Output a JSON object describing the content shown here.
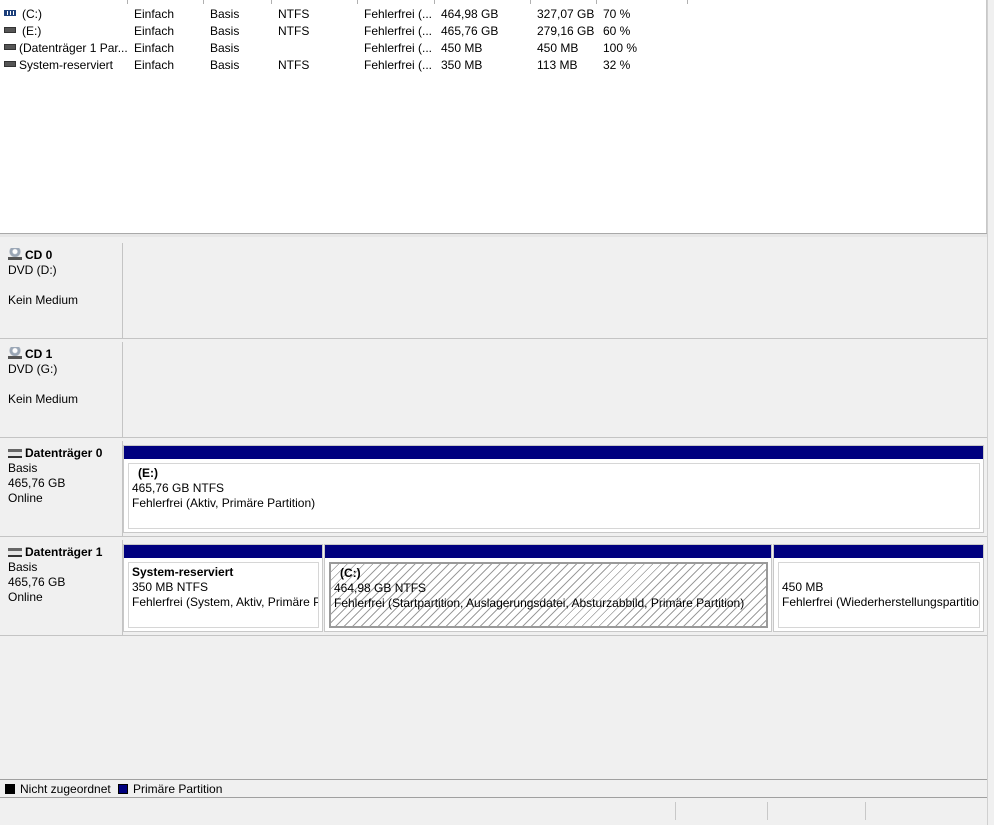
{
  "volumes": [
    {
      "icon": "striped-volume-icon",
      "name": "(C:)",
      "layout": "Einfach",
      "type": "Basis",
      "fs": "NTFS",
      "status": "Fehlerfrei (...",
      "capacity": "464,98 GB",
      "free": "327,07 GB",
      "pct": "70 %"
    },
    {
      "icon": "volume-icon",
      "name": "(E:)",
      "layout": "Einfach",
      "type": "Basis",
      "fs": "NTFS",
      "status": "Fehlerfrei (...",
      "capacity": "465,76 GB",
      "free": "279,16 GB",
      "pct": "60 %"
    },
    {
      "icon": "volume-icon",
      "name": "(Datenträger 1 Par...",
      "layout": "Einfach",
      "type": "Basis",
      "fs": "",
      "status": "Fehlerfrei (...",
      "capacity": "450 MB",
      "free": "450 MB",
      "pct": "100 %"
    },
    {
      "icon": "volume-icon",
      "name": "System-reserviert",
      "layout": "Einfach",
      "type": "Basis",
      "fs": "NTFS",
      "status": "Fehlerfrei (...",
      "capacity": "350 MB",
      "free": "113 MB",
      "pct": "32 %"
    }
  ],
  "disks": {
    "cd0": {
      "name": "CD 0",
      "line1": "DVD (D:)",
      "line2": "Kein Medium"
    },
    "cd1": {
      "name": "CD 1",
      "line1": "DVD (G:)",
      "line2": "Kein Medium"
    },
    "disk0": {
      "name": "Datenträger 0",
      "type": "Basis",
      "size": "465,76 GB",
      "state": "Online",
      "partitions": [
        {
          "title": "(E:)",
          "size": "465,76 GB NTFS",
          "status": "Fehlerfrei (Aktiv, Primäre Partition)"
        }
      ]
    },
    "disk1": {
      "name": "Datenträger 1",
      "type": "Basis",
      "size": "465,76 GB",
      "state": "Online",
      "partitions": [
        {
          "title": "System-reserviert",
          "size": "350 MB NTFS",
          "status": "Fehlerfrei (System, Aktiv, Primäre P"
        },
        {
          "title": "(C:)",
          "size": "464,98 GB NTFS",
          "status": "Fehlerfrei (Startpartition, Auslagerungsdatei, Absturzabbild, Primäre Partition)"
        },
        {
          "title": "",
          "size": "450 MB",
          "status": "Fehlerfrei (Wiederherstellungspartitio"
        }
      ]
    }
  },
  "legend": {
    "unallocated": {
      "label": "Nicht zugeordnet",
      "color": "#000000"
    },
    "primary": {
      "label": "Primäre Partition",
      "color": "#00007f"
    }
  },
  "colors": {
    "partition_bar": "#00007f",
    "background": "#f0f0f0"
  }
}
